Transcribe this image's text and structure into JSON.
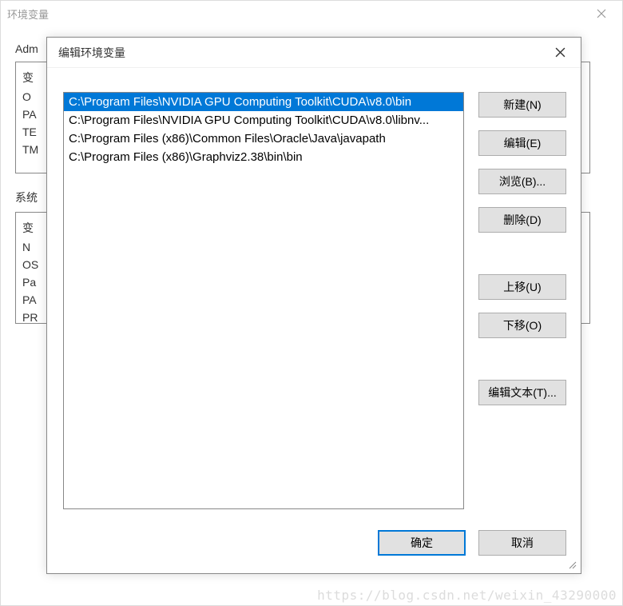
{
  "outer": {
    "title": "环境变量",
    "user_vars_label": "Adm",
    "user_vars": [
      "变",
      "O",
      "PA",
      "TE",
      "TM"
    ],
    "system_vars_label": "系统",
    "system_vars": [
      "变",
      "N",
      "OS",
      "Pa",
      "PA",
      "PR"
    ]
  },
  "dialog": {
    "title": "编辑环境变量",
    "paths": [
      "C:\\Program Files\\NVIDIA GPU Computing Toolkit\\CUDA\\v8.0\\bin",
      "C:\\Program Files\\NVIDIA GPU Computing Toolkit\\CUDA\\v8.0\\libnv...",
      "C:\\Program Files (x86)\\Common Files\\Oracle\\Java\\javapath",
      "C:\\Program Files (x86)\\Graphviz2.38\\bin\\bin"
    ],
    "selected_index": 0,
    "buttons": {
      "new": "新建(N)",
      "edit": "编辑(E)",
      "browse": "浏览(B)...",
      "delete": "删除(D)",
      "moveup": "上移(U)",
      "movedown": "下移(O)",
      "edittext": "编辑文本(T)..."
    },
    "footer": {
      "ok": "确定",
      "cancel": "取消"
    }
  },
  "watermark": "https://blog.csdn.net/weixin_43290000"
}
